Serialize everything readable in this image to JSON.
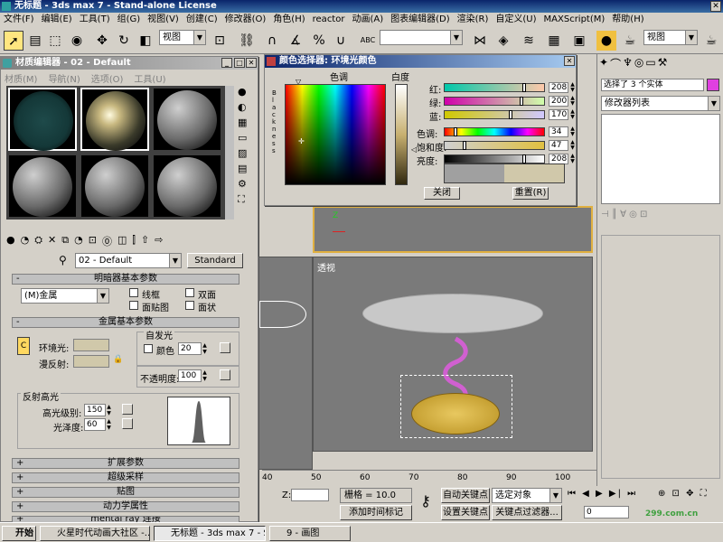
{
  "app": {
    "title": "无标题 - 3ds max 7 - Stand-alone License"
  },
  "menu": [
    "文件(F)",
    "编辑(E)",
    "工具(T)",
    "组(G)",
    "视图(V)",
    "创建(C)",
    "修改器(O)",
    "角色(H)",
    "reactor",
    "动画(A)",
    "图表编辑器(D)",
    "渲染(R)",
    "自定义(U)",
    "MAXScript(M)",
    "帮助(H)"
  ],
  "toolbar": {
    "view_combo_left": "视图",
    "view_combo_right": "视图",
    "abc_label": "ABC"
  },
  "material_editor": {
    "title": "材质编辑器 - 02 - Default",
    "menu": [
      "材质(M)",
      "导航(N)",
      "选项(O)",
      "工具(U)"
    ],
    "material_name": "02 - Default",
    "type_button": "Standard",
    "rollouts": {
      "basic_params": "明暗器基本参数",
      "metal_params": "金属基本参数",
      "extended": "扩展参数",
      "supersampling": "超级采样",
      "maps": "贴图",
      "dynamics": "动力学属性",
      "mental_ray": "mental ray 连接"
    },
    "shader": "(M)金属",
    "checkboxes": [
      "线框",
      "双面",
      "面贴图",
      "面状"
    ],
    "ambient_label": "环境光:",
    "diffuse_label": "漫反射:",
    "self_illum_group": "自发光",
    "color_label": "颜色",
    "self_illum_value": "20",
    "opacity_label": "不透明度:",
    "opacity_value": "100",
    "highlight_group": "反射高光",
    "spec_level_label": "高光级别:",
    "spec_level_value": "150",
    "gloss_label": "光泽度:",
    "gloss_value": "60"
  },
  "color_picker": {
    "title": "颜色选择器: 环境光颜色",
    "hue_label": "色调",
    "whiteness_label": "白度",
    "blackness_label": "Blackness",
    "channels": [
      {
        "label": "红:",
        "value": "208"
      },
      {
        "label": "绿:",
        "value": "200"
      },
      {
        "label": "蓝:",
        "value": "170"
      },
      {
        "label": "色调:",
        "value": "34"
      },
      {
        "label": "饱和度:",
        "value": "47"
      },
      {
        "label": "亮度:",
        "value": "208"
      }
    ],
    "close_button": "关闭",
    "reset_button": "重置(R)",
    "old_color": "#a0a0a0",
    "new_color": "#d0c8aa"
  },
  "command_panel": {
    "selection_text": "选择了 3 个实体",
    "modifier_list": "修改器列表"
  },
  "viewport": {
    "label": "透视",
    "ruler_ticks": [
      "40",
      "50",
      "60",
      "70",
      "80",
      "90",
      "100"
    ]
  },
  "status": {
    "z_label": "Z:",
    "grid_text": "栅格 = 10.0",
    "add_time_tag": "添加时间标记",
    "auto_key": "自动关键点",
    "set_key": "设置关键点",
    "selected_object": "选定对象",
    "key_filters": "关键点过滤器...",
    "frame_value": "0",
    "watermark": "299.com.cn"
  },
  "taskbar": {
    "start": "开始",
    "tasks": [
      "火星时代动画大社区 -...",
      "无标题 - 3ds max 7 - St...",
      "9 - 画图"
    ]
  }
}
